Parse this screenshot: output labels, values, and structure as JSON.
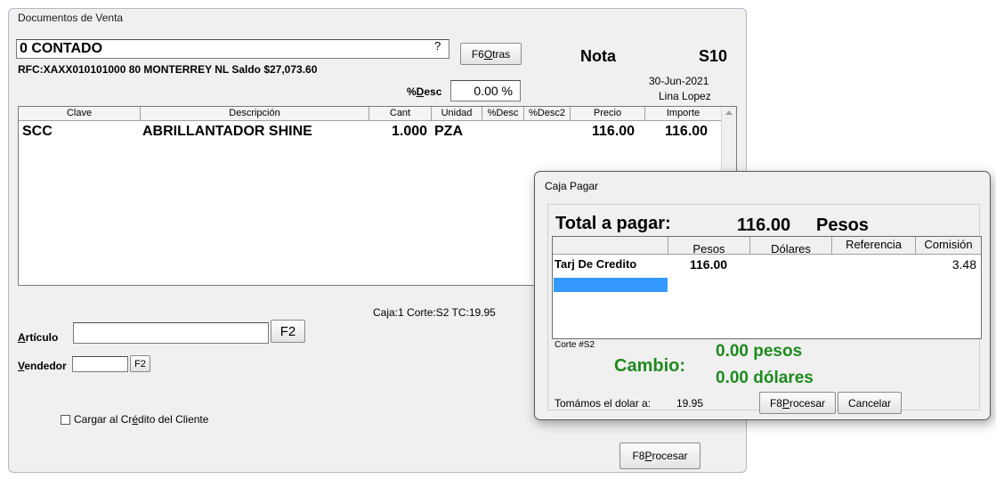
{
  "main": {
    "title": "Documentos de Venta",
    "customer": {
      "name": "0 CONTADO",
      "help": "?",
      "info": "RFC:XAXX010101000  80  MONTERREY NL   Saldo $27,073.60"
    },
    "otras_button": {
      "prefix": "F6 ",
      "hotkey": "O",
      "rest": "tras"
    },
    "doc_type": "Nota",
    "doc_series": "S10",
    "date": "30-Jun-2021",
    "user": "Lina Lopez",
    "discount": {
      "label_prefix": "%",
      "hotkey": "D",
      "label_rest": "esc",
      "value": "0.00 %"
    },
    "grid": {
      "headers": [
        "Clave",
        "Descripción",
        "Cant",
        "Unidad",
        "%Desc",
        "%Desc2",
        "Precio",
        "Importe"
      ],
      "rows": [
        {
          "clave": "SCC",
          "descripcion": "ABRILLANTADOR SHINE",
          "cant": "1.000",
          "unidad": "PZA",
          "precio": "116.00",
          "importe": "116.00"
        }
      ]
    },
    "caja_info": "Caja:1  Corte:S2  TC:19.95",
    "articulo": {
      "hotkey": "A",
      "label_rest": "rtículo",
      "value": "",
      "f2": "F2"
    },
    "vendedor": {
      "hotkey": "V",
      "label_rest": "endedor",
      "value": "",
      "f2": "F2"
    },
    "credit": {
      "prefix": "Cargar al Cr",
      "hotkey": "é",
      "rest": "dito del Cliente",
      "checked": false
    },
    "procesar_button": {
      "prefix": "F8 ",
      "hotkey": "P",
      "rest": "rocesar"
    }
  },
  "dialog": {
    "title": "Caja Pagar",
    "total_label": "Total a pagar:",
    "total_amount": "116.00",
    "total_currency": "Pesos",
    "headers": [
      "Pesos",
      "Dólares",
      "Referencia",
      "Comisión"
    ],
    "payment": {
      "method": "Tarj De Credito",
      "amount": "116.00",
      "commission": "3.48"
    },
    "corte": "Corte #S2",
    "cambio_label": "Cambio:",
    "cambio_pesos": "0.00 pesos",
    "cambio_dolares": "0.00 dólares",
    "dollar_rate_label": "Tomámos el dolar a:",
    "dollar_rate": "19.95",
    "procesar_button": {
      "prefix": "F8 ",
      "hotkey": "P",
      "rest": "rocesar"
    },
    "cancel_button": "Cancelar",
    "colors": {
      "cambio": "#1e8a1e",
      "selection": "#3399ff"
    }
  }
}
